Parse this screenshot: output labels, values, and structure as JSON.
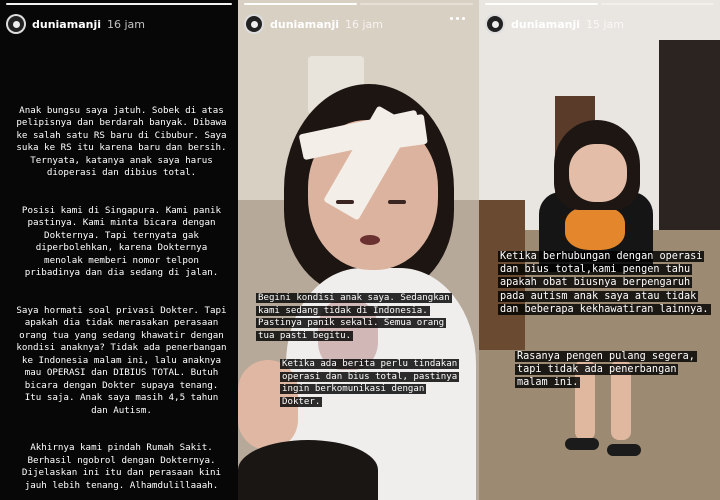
{
  "stories": [
    {
      "username": "duniamanji",
      "time": "16 jam",
      "paragraphs": [
        "Anak bungsu saya jatuh. Sobek di atas pelipisnya dan berdarah banyak. Dibawa ke salah satu RS baru di Cibubur. Saya suka ke RS itu karena baru dan bersih. Ternyata, katanya anak saya harus dioperasi dan dibius total.",
        "Posisi kami di Singapura. Kami panik pastinya. Kami minta bicara dengan Dokternya. Tapi ternyata gak diperbolehkan, karena Dokternya menolak memberi nomor telpon pribadinya dan dia sedang di jalan.",
        "Saya hormati soal privasi Dokter. Tapi apakah dia tidak merasakan perasaan orang tua yang sedang khawatir dengan kondisi anaknya? Tidak ada penerbangan ke Indonesia malam ini, lalu anaknya mau OPERASI dan DIBIUS TOTAL. Butuh bicara dengan Dokter supaya tenang. Itu saja. Anak saya masih 4,5 tahun dan Autism.",
        "Akhirnya kami pindah Rumah Sakit. Berhasil ngobrol dengan Dokternya. Dijelaskan ini itu dan perasaan kini jauh lebih tenang. Alhamdulillaaah."
      ]
    },
    {
      "username": "duniamanji",
      "time": "16 jam",
      "caption_1": "Begini kondisi anak saya. Sedangkan kami sedang tidak di Indonesia. Pastinya panik sekali. Semua orang tua pasti begitu.",
      "caption_2": "Ketika ada berita perlu tindakan operasi dan bius total, pastinya ingin berkomunikasi dengan Dokter."
    },
    {
      "username": "duniamanji",
      "time": "15 jam",
      "caption_1": "Ketika berhubungan dengan operasi dan bius total,kami pengen tahu apakah obat biusnya berpengaruh pada autism anak saya atau tidak dan beberapa kekhawatiran lainnya.",
      "caption_2": "Rasanya pengen pulang segera, tapi tidak ada penerbangan malam ini."
    }
  ],
  "icons": {
    "avatar": "avatar-icon",
    "more": "more-options-icon"
  },
  "colors": {
    "background": "#000000",
    "caption_bg": "#000000",
    "text": "#ffffff"
  }
}
